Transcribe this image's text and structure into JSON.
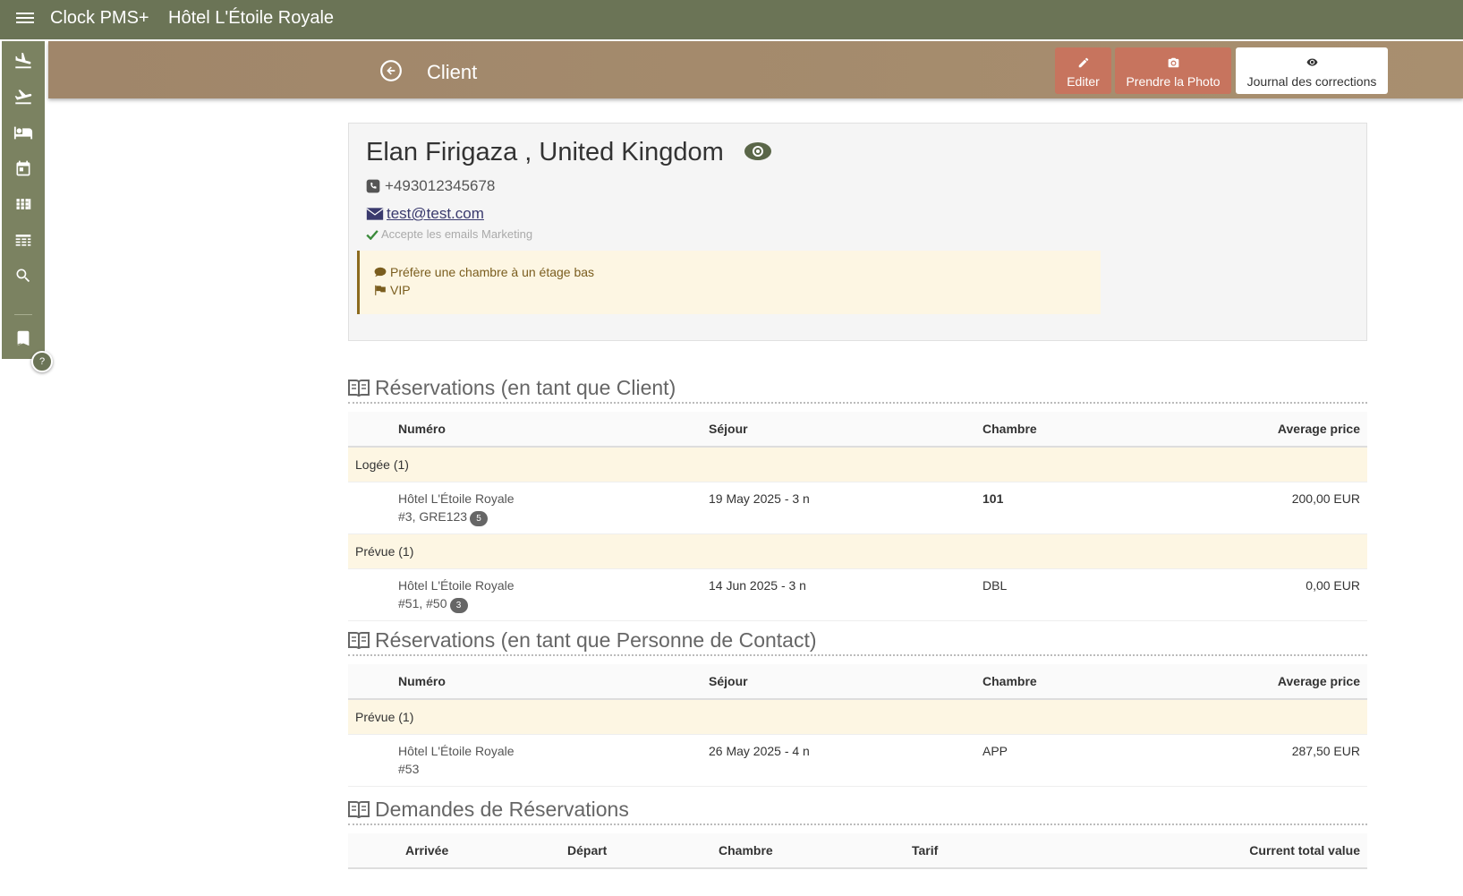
{
  "topbar": {
    "app_name": "Clock PMS+",
    "hotel_name": "Hôtel L'Étoile Royale"
  },
  "sidebar": {
    "items": [
      {
        "icon": "arrivals-icon"
      },
      {
        "icon": "departures-icon"
      },
      {
        "icon": "bed-icon"
      },
      {
        "icon": "calendar-icon"
      },
      {
        "icon": "grid-icon"
      },
      {
        "icon": "list-icon"
      },
      {
        "icon": "search-icon"
      },
      {
        "icon": "bookmark-icon"
      }
    ],
    "help_label": "?"
  },
  "header": {
    "title": "Client",
    "buttons": {
      "edit": "Editer",
      "photo": "Prendre la Photo",
      "log": "Journal des corrections"
    }
  },
  "client": {
    "name": "Elan Firigaza , United Kingdom",
    "phone": "+493012345678",
    "email": "test@test.com",
    "marketing": "Accepte les emails Marketing",
    "notes": [
      "Préfère une chambre à un étage bas",
      "VIP"
    ]
  },
  "sections": {
    "client_res": {
      "title": "Réservations (en tant que Client)",
      "headers": [
        "Numéro",
        "Séjour",
        "Chambre",
        "Average price"
      ],
      "groups": [
        {
          "label": "Logée (1)",
          "rows": [
            {
              "hotel": "Hôtel L'Étoile Royale",
              "ref": "#3, GRE123",
              "badge": "5",
              "stay": "19 May 2025 - 3 n",
              "room": "101",
              "price": "200,00 EUR"
            }
          ]
        },
        {
          "label": "Prévue (1)",
          "rows": [
            {
              "hotel": "Hôtel L'Étoile Royale",
              "ref": "#51, #50",
              "badge": "3",
              "stay": "14 Jun 2025 - 3 n",
              "room": "DBL",
              "price": "0,00 EUR"
            }
          ]
        }
      ]
    },
    "contact_res": {
      "title": "Réservations (en tant que Personne de Contact)",
      "headers": [
        "Numéro",
        "Séjour",
        "Chambre",
        "Average price"
      ],
      "groups": [
        {
          "label": "Prévue (1)",
          "rows": [
            {
              "hotel": "Hôtel L'Étoile Royale",
              "ref": "#53",
              "stay": "26 May 2025 - 4 n",
              "room": "APP",
              "price": "287,50 EUR"
            }
          ]
        }
      ]
    },
    "requests": {
      "title": "Demandes de Réservations",
      "headers": [
        "Arrivée",
        "Départ",
        "Chambre",
        "Tarif",
        "Current total value"
      ]
    }
  }
}
